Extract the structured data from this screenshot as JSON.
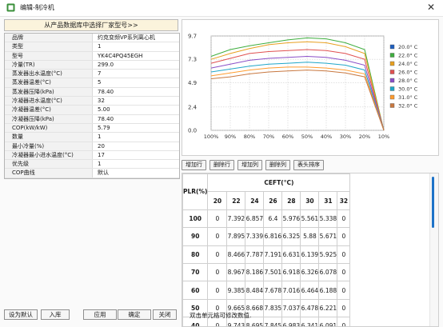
{
  "window": {
    "title": "编辑-制冷机",
    "close_glyph": "✕"
  },
  "left": {
    "pick_button": "从产品数据库中选择厂家型号>>",
    "properties": [
      {
        "key": "品牌",
        "value": "约克变频VP系列离心机"
      },
      {
        "key": "类型",
        "value": "1"
      },
      {
        "key": "型号",
        "value": "YK4C4PQ45EGH"
      },
      {
        "key": "冷量(TR)",
        "value": "299.0"
      },
      {
        "key": "蒸发器出水温度(°C)",
        "value": "7"
      },
      {
        "key": "蒸发器温差(°C)",
        "value": "5"
      },
      {
        "key": "蒸发器压降(kPa)",
        "value": "78.40"
      },
      {
        "key": "冷凝器进水温度(°C)",
        "value": "32"
      },
      {
        "key": "冷凝器温差(°C)",
        "value": "5.00"
      },
      {
        "key": "冷凝器压降(kPa)",
        "value": "78.40"
      },
      {
        "key": "COP(kW/kW)",
        "value": "5.79"
      },
      {
        "key": "数量",
        "value": "1"
      },
      {
        "key": "最小冷量(%)",
        "value": "20"
      },
      {
        "key": "冷凝器最小进水温度(°C)",
        "value": "17"
      },
      {
        "key": "优先级",
        "value": "1"
      },
      {
        "key": "COP曲线",
        "value": "默认"
      }
    ]
  },
  "chart_data": {
    "type": "line",
    "x": [
      "100%",
      "90%",
      "80%",
      "70%",
      "60%",
      "50%",
      "40%",
      "30%",
      "20%",
      "10%"
    ],
    "ylim": [
      0.0,
      9.7
    ],
    "yticks": [
      "0.0",
      "2.4",
      "4.9",
      "7.3",
      "9.7"
    ],
    "grid": true,
    "legend_position": "right",
    "series": [
      {
        "name": "20.0° C",
        "color": "#1f5fbf",
        "values": [
          null,
          null,
          null,
          null,
          null,
          null,
          null,
          null,
          null,
          null
        ]
      },
      {
        "name": "22.0° C",
        "color": "#3fae3f",
        "values": [
          7.6,
          8.3,
          8.7,
          9.0,
          9.3,
          9.5,
          9.4,
          9.0,
          8.3,
          0.0
        ]
      },
      {
        "name": "24.0° C",
        "color": "#e8a020",
        "values": [
          7.3,
          7.9,
          8.4,
          8.8,
          9.0,
          9.1,
          9.0,
          8.6,
          7.9,
          0.0
        ]
      },
      {
        "name": "26.0° C",
        "color": "#e05050",
        "values": [
          6.9,
          7.4,
          7.9,
          8.1,
          8.2,
          8.3,
          8.2,
          7.9,
          7.3,
          0.0
        ]
      },
      {
        "name": "28.0° C",
        "color": "#8a4fc8",
        "values": [
          6.4,
          6.8,
          7.2,
          7.4,
          7.5,
          7.6,
          7.5,
          7.2,
          6.7,
          0.0
        ]
      },
      {
        "name": "30.0° C",
        "color": "#20a6c8",
        "values": [
          6.0,
          6.3,
          6.6,
          6.8,
          6.9,
          7.0,
          6.9,
          6.7,
          6.2,
          0.0
        ]
      },
      {
        "name": "31.0° C",
        "color": "#ff9b2e",
        "values": [
          5.6,
          5.9,
          6.2,
          6.4,
          6.5,
          6.5,
          6.4,
          6.2,
          5.8,
          0.0
        ]
      },
      {
        "name": "32.0° C",
        "color": "#c87840",
        "values": [
          5.3,
          5.5,
          5.8,
          6.0,
          6.1,
          6.2,
          6.1,
          5.9,
          5.5,
          0.0
        ]
      }
    ]
  },
  "table_buttons": [
    "增加行",
    "删除行",
    "增加列",
    "删除列",
    "表头排序"
  ],
  "table": {
    "header_row": "PLR(%)",
    "header_group": "CEFT(°C)",
    "columns": [
      "20",
      "22",
      "24",
      "26",
      "28",
      "30",
      "31",
      "32"
    ],
    "rows": [
      {
        "plr": "100",
        "cells": [
          "0",
          "7.392",
          "6.857",
          "6.4",
          "5.976",
          "5.561",
          "5.338",
          "0"
        ]
      },
      {
        "plr": "90",
        "cells": [
          "0",
          "7.895",
          "7.339",
          "6.816",
          "6.325",
          "5.88",
          "5.671",
          "0"
        ]
      },
      {
        "plr": "80",
        "cells": [
          "0",
          "8.466",
          "7.787",
          "7.191",
          "6.631",
          "6.139",
          "5.925",
          "0"
        ]
      },
      {
        "plr": "70",
        "cells": [
          "0",
          "8.967",
          "8.186",
          "7.501",
          "6.918",
          "6.326",
          "6.078",
          "0"
        ]
      },
      {
        "plr": "60",
        "cells": [
          "0",
          "9.385",
          "8.484",
          "7.678",
          "7.016",
          "6.464",
          "6.188",
          "0"
        ]
      },
      {
        "plr": "50",
        "cells": [
          "0",
          "9.665",
          "8.668",
          "7.835",
          "7.037",
          "6.478",
          "6.221",
          "0"
        ]
      },
      {
        "plr": "40",
        "cells": [
          "0",
          "9.743",
          "8.695",
          "7.845",
          "6.983",
          "6.341",
          "6.091",
          "0"
        ]
      }
    ]
  },
  "bottom": {
    "set_default": "设为默认",
    "import": "入库",
    "apply": "应用",
    "ok": "确定",
    "close": "关闭",
    "hint": "双击单元格可修改数值."
  }
}
